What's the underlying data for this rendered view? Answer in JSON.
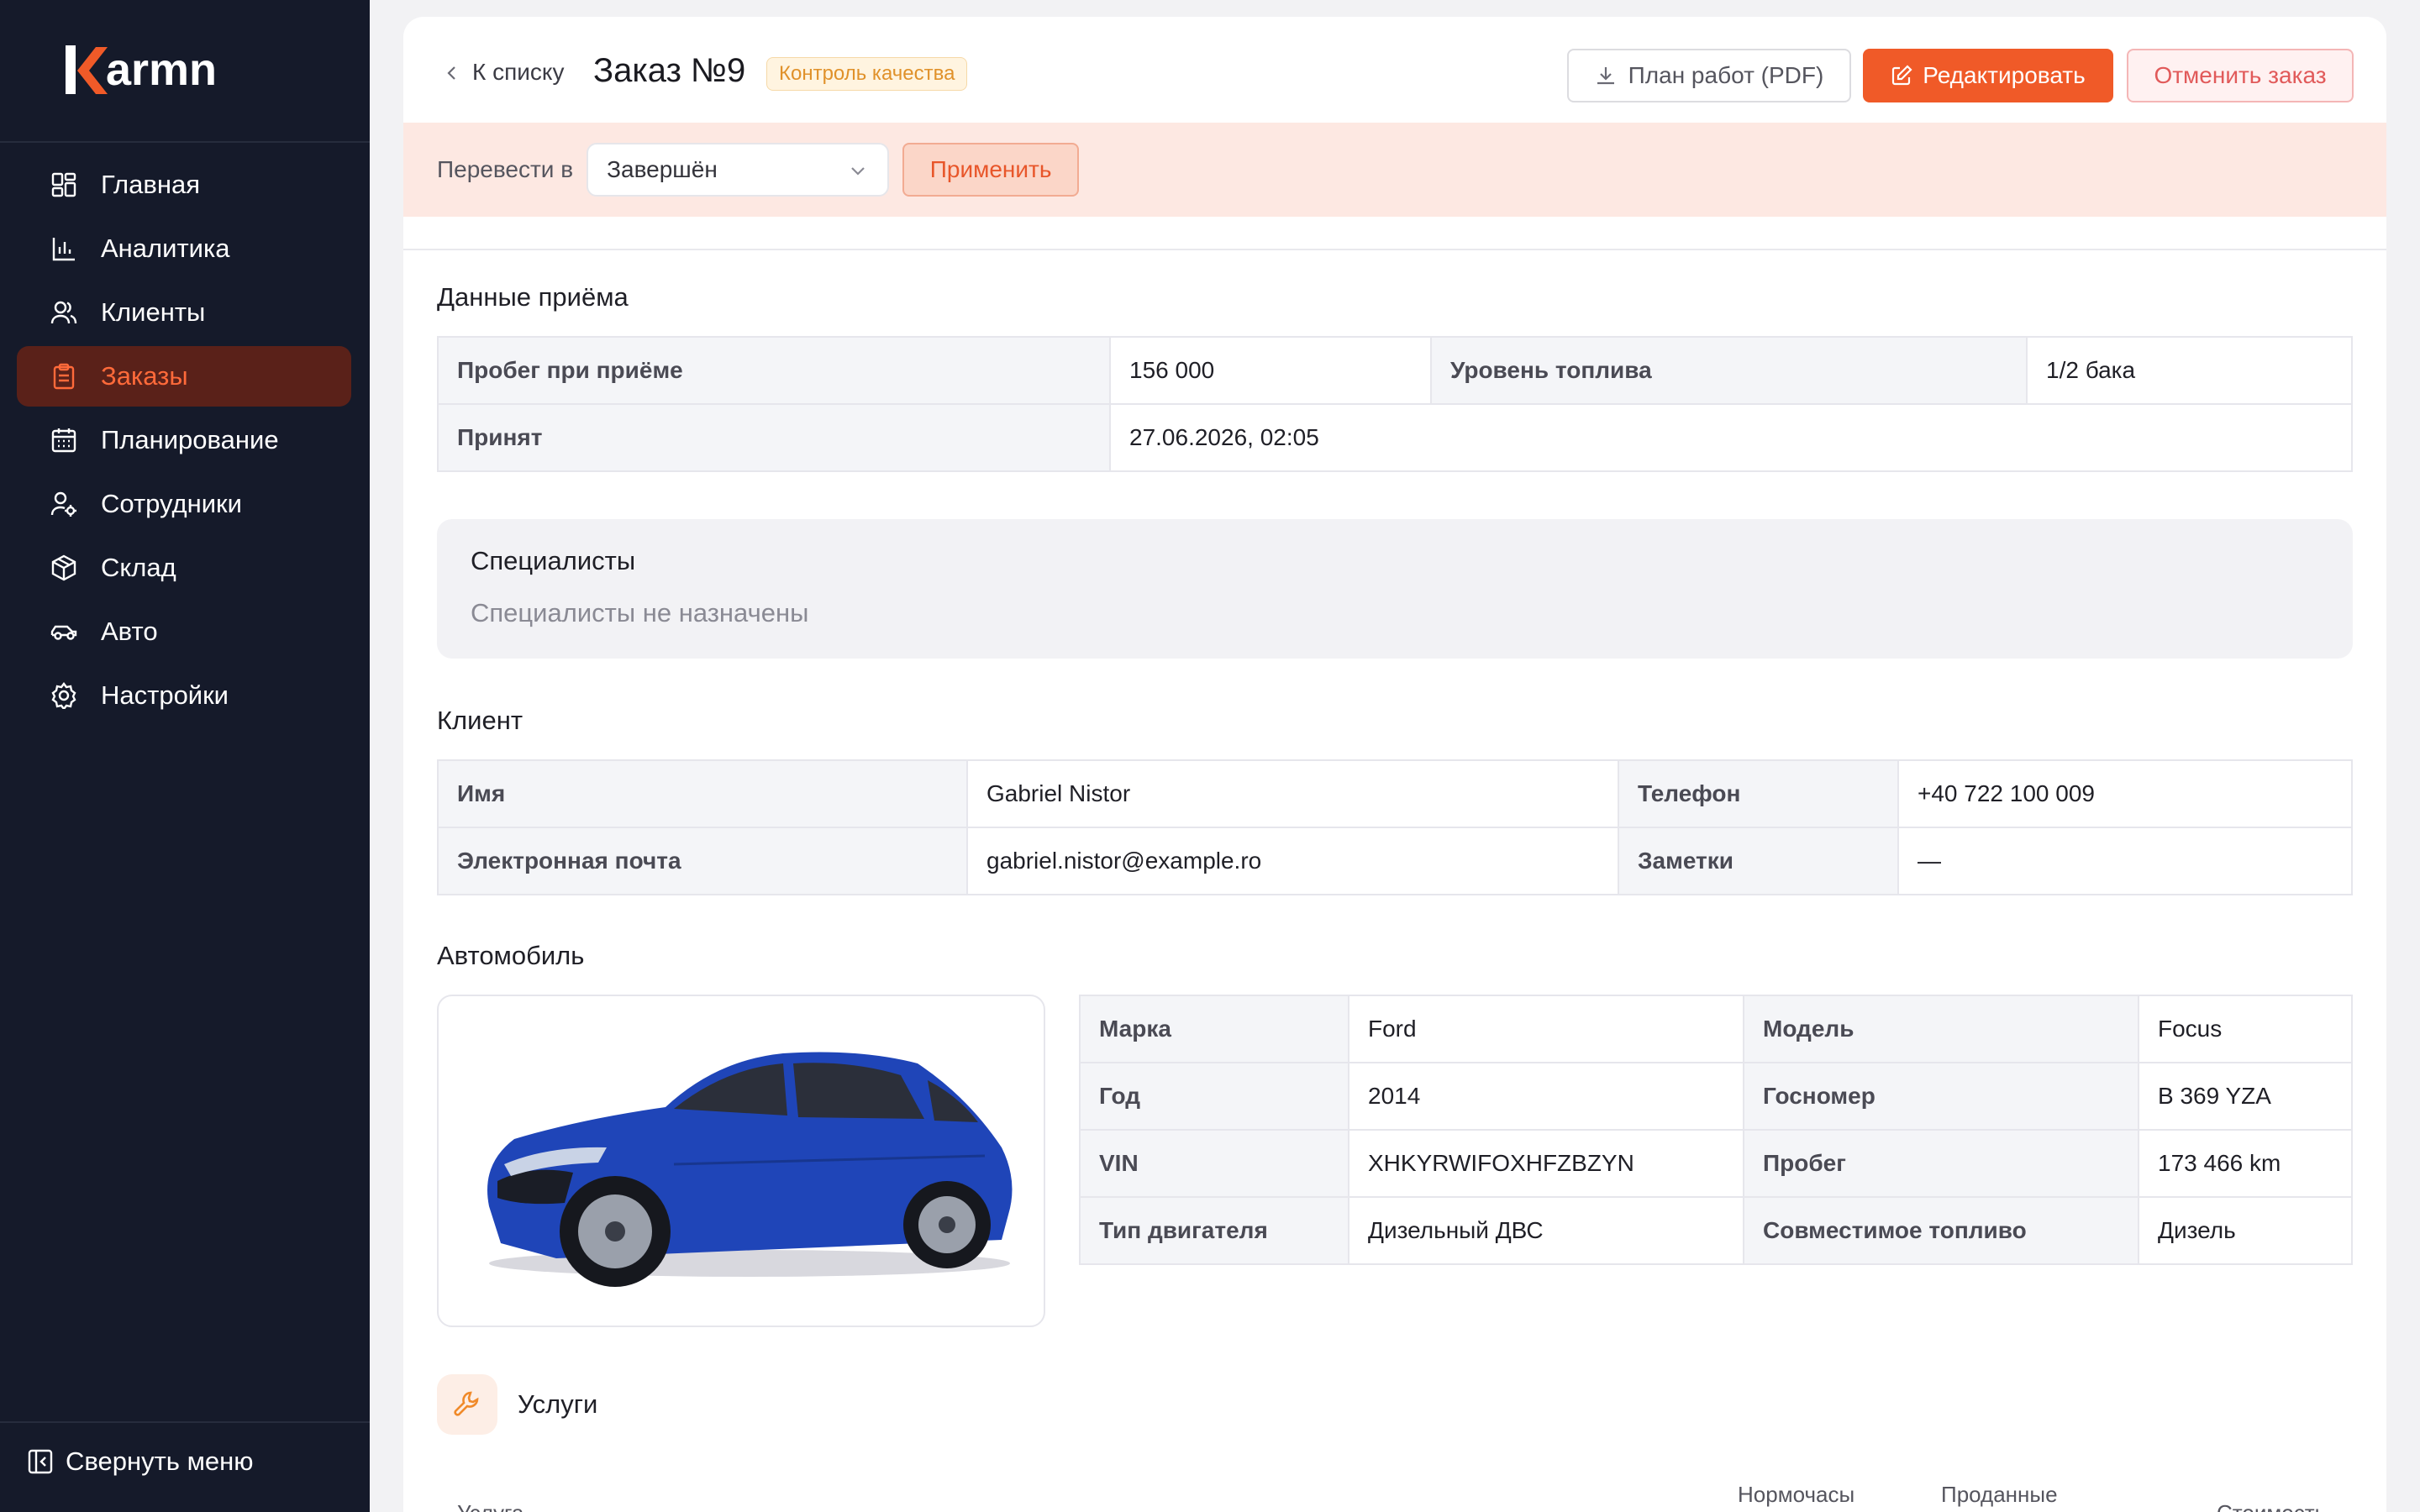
{
  "brand": {
    "name": "armn",
    "accent": "#f05a28",
    "sidebar_bg": "#151a2a"
  },
  "sidebar": {
    "items": [
      {
        "label": "Главная",
        "icon": "dashboard-icon",
        "active": false
      },
      {
        "label": "Аналитика",
        "icon": "bar-chart-icon",
        "active": false
      },
      {
        "label": "Клиенты",
        "icon": "users-icon",
        "active": false
      },
      {
        "label": "Заказы",
        "icon": "clipboard-icon",
        "active": true
      },
      {
        "label": "Планирование",
        "icon": "calendar-icon",
        "active": false
      },
      {
        "label": "Сотрудники",
        "icon": "user-gear-icon",
        "active": false
      },
      {
        "label": "Склад",
        "icon": "box-icon",
        "active": false
      },
      {
        "label": "Авто",
        "icon": "car-icon",
        "active": false
      },
      {
        "label": "Настройки",
        "icon": "gear-icon",
        "active": false
      }
    ],
    "collapse_label": "Свернуть меню"
  },
  "header": {
    "back_label": "К списку",
    "title": "Заказ №9",
    "status": "Контроль качества",
    "pdf_label": "План работ (PDF)",
    "edit_label": "Редактировать",
    "cancel_label": "Отменить заказ"
  },
  "transfer": {
    "label": "Перевести в",
    "selected": "Завершён",
    "apply_label": "Применить"
  },
  "intake": {
    "title": "Данные приёма",
    "mileage_label": "Пробег при приёме",
    "mileage_value": "156 000",
    "fuel_label": "Уровень топлива",
    "fuel_value": "1/2 бака",
    "accepted_label": "Принят",
    "accepted_value": "27.06.2026, 02:05"
  },
  "specialists": {
    "title": "Специалисты",
    "empty": "Специалисты не назначены"
  },
  "client": {
    "title": "Клиент",
    "name_label": "Имя",
    "name_value": "Gabriel Nistor",
    "phone_label": "Телефон",
    "phone_value": "+40 722 100 009",
    "email_label": "Электронная почта",
    "email_value": "gabriel.nistor@example.ro",
    "notes_label": "Заметки",
    "notes_value": "—"
  },
  "vehicle": {
    "title": "Автомобиль",
    "make_label": "Марка",
    "make_value": "Ford",
    "model_label": "Модель",
    "model_value": "Focus",
    "year_label": "Год",
    "year_value": "2014",
    "plate_label": "Госномер",
    "plate_value": "B 369 YZA",
    "vin_label": "VIN",
    "vin_value": "XHKYRWIFOXHFZBZYN",
    "odometer_label": "Пробег",
    "odometer_value": "173 466 km",
    "engine_label": "Тип двигателя",
    "engine_value": "Дизельный ДВС",
    "fuel_label": "Совместимое топливо",
    "fuel_value": "Дизель",
    "car_color": "#1f45b8"
  },
  "services": {
    "title": "Услуги",
    "columns": [
      "Услуга",
      "Нормочасы",
      "Проданные",
      "Стоимость"
    ]
  }
}
